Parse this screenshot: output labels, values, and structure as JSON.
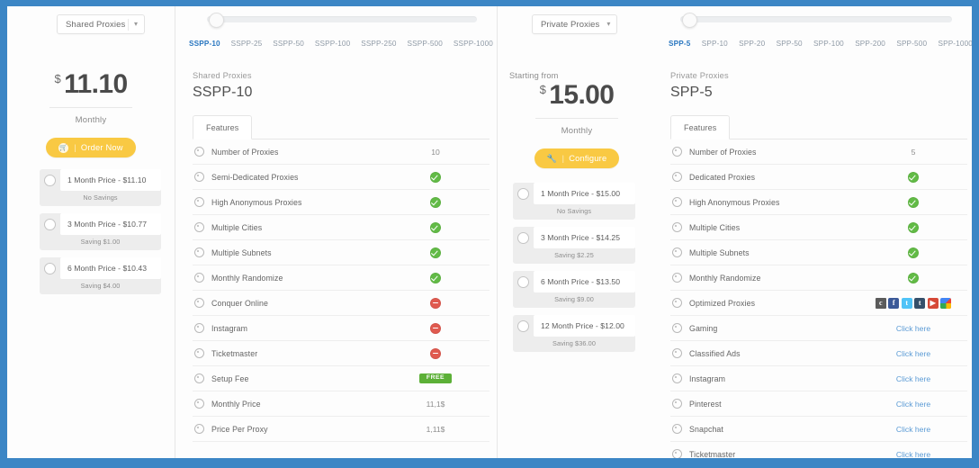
{
  "theme": {
    "frame_border_color": "#3c86c5",
    "accent_blue": "#2a77c0",
    "cta_yellow": "#f9c943",
    "yes_green": "#62bb46",
    "no_red": "#e05a4f",
    "free_badge_green": "#5cb037",
    "link_blue": "#5b9bd5"
  },
  "shared": {
    "dropdown_label": "Shared Proxies",
    "caret_icon": "chevron-down-icon",
    "slider": {
      "ticks": [
        {
          "label": "SSPP-10",
          "active": true
        },
        {
          "label": "SSPP-25",
          "active": false
        },
        {
          "label": "SSPP-50",
          "active": false
        },
        {
          "label": "SSPP-100",
          "active": false
        },
        {
          "label": "SSPP-250",
          "active": false
        },
        {
          "label": "SSPP-500",
          "active": false
        },
        {
          "label": "SSPP-1000",
          "active": false
        }
      ]
    },
    "price": {
      "currency": "$",
      "amount": "11.10",
      "period": "Monthly"
    },
    "cta": {
      "icon": "cart-icon",
      "separator": "|",
      "label": "Order Now"
    },
    "terms": [
      {
        "label": "1 Month Price - $11.10",
        "saving": "No Savings",
        "selected": false
      },
      {
        "label": "3 Month Price - $10.77",
        "saving": "Saving $1.00",
        "selected": false
      },
      {
        "label": "6 Month Price - $10.43",
        "saving": "Saving $4.00",
        "selected": false
      }
    ],
    "panel": {
      "kicker": "Shared Proxies",
      "title": "SSPP-10",
      "tab_label": "Features",
      "features": [
        {
          "name": "Number of Proxies",
          "type": "text",
          "value": "10"
        },
        {
          "name": "Semi-Dedicated Proxies",
          "type": "yes",
          "value": ""
        },
        {
          "name": "High Anonymous Proxies",
          "type": "yes",
          "value": ""
        },
        {
          "name": "Multiple Cities",
          "type": "yes",
          "value": ""
        },
        {
          "name": "Multiple Subnets",
          "type": "yes",
          "value": ""
        },
        {
          "name": "Monthly Randomize",
          "type": "yes",
          "value": ""
        },
        {
          "name": "Conquer Online",
          "type": "no",
          "value": ""
        },
        {
          "name": "Instagram",
          "type": "no",
          "value": ""
        },
        {
          "name": "Ticketmaster",
          "type": "no",
          "value": ""
        },
        {
          "name": "Setup Fee",
          "type": "badge",
          "value": "FREE"
        },
        {
          "name": "Monthly Price",
          "type": "text",
          "value": "11,1$"
        },
        {
          "name": "Price Per Proxy",
          "type": "text",
          "value": "1,11$"
        }
      ]
    }
  },
  "private": {
    "dropdown_label": "Private Proxies",
    "caret_icon": "chevron-down-icon",
    "slider": {
      "ticks": [
        {
          "label": "SPP-5",
          "active": true
        },
        {
          "label": "SPP-10",
          "active": false
        },
        {
          "label": "SPP-20",
          "active": false
        },
        {
          "label": "SPP-50",
          "active": false
        },
        {
          "label": "SPP-100",
          "active": false
        },
        {
          "label": "SPP-200",
          "active": false
        },
        {
          "label": "SPP-500",
          "active": false
        },
        {
          "label": "SPP-1000",
          "active": false
        }
      ]
    },
    "price": {
      "starting_from": "Starting from",
      "currency": "$",
      "amount": "15.00",
      "period": "Monthly"
    },
    "cta": {
      "icon": "wrench-icon",
      "separator": "|",
      "label": "Configure"
    },
    "terms": [
      {
        "label": "1 Month Price - $15.00",
        "saving": "No Savings",
        "selected": false
      },
      {
        "label": "3 Month Price - $14.25",
        "saving": "Saving $2.25",
        "selected": false
      },
      {
        "label": "6 Month Price - $13.50",
        "saving": "Saving $9.00",
        "selected": false
      },
      {
        "label": "12 Month Price - $12.00",
        "saving": "Saving $36.00",
        "selected": false
      }
    ],
    "panel": {
      "kicker": "Private Proxies",
      "title": "SPP-5",
      "tab_label": "Features",
      "features": [
        {
          "name": "Number of Proxies",
          "type": "text",
          "value": "5"
        },
        {
          "name": "Dedicated Proxies",
          "type": "yes",
          "value": ""
        },
        {
          "name": "High Anonymous Proxies",
          "type": "yes",
          "value": ""
        },
        {
          "name": "Multiple Cities",
          "type": "yes",
          "value": ""
        },
        {
          "name": "Multiple Subnets",
          "type": "yes",
          "value": ""
        },
        {
          "name": "Monthly Randomize",
          "type": "yes",
          "value": ""
        },
        {
          "name": "Optimized Proxies",
          "type": "social",
          "value": "",
          "social": [
            "craigslist-icon",
            "facebook-icon",
            "twitter-icon",
            "tumblr-icon",
            "youtube-icon",
            "google-icon"
          ]
        },
        {
          "name": "Gaming",
          "type": "link",
          "value": "Click here"
        },
        {
          "name": "Classified Ads",
          "type": "link",
          "value": "Click here"
        },
        {
          "name": "Instagram",
          "type": "link",
          "value": "Click here"
        },
        {
          "name": "Pinterest",
          "type": "link",
          "value": "Click here"
        },
        {
          "name": "Snapchat",
          "type": "link",
          "value": "Click here"
        },
        {
          "name": "Ticketmaster",
          "type": "link",
          "value": "Click here"
        }
      ]
    }
  }
}
